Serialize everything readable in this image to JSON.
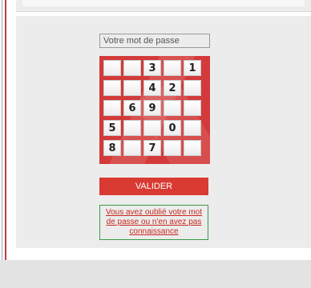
{
  "password": {
    "placeholder": "Votre mot de passe",
    "value": ""
  },
  "keypad": {
    "cells": [
      "",
      "",
      "3",
      "",
      "1",
      "",
      "",
      "4",
      "2",
      "",
      "",
      "6",
      "9",
      "",
      "",
      "5",
      "",
      "",
      "0",
      "",
      "8",
      "",
      "7",
      "",
      ""
    ]
  },
  "submit": {
    "label": "VALIDER"
  },
  "forgot": {
    "text": "Vous avez oublié votre mot de passe ou n'en avez pas connaissance"
  },
  "colors": {
    "accent": "#d93a32",
    "link": "#c8281e",
    "forgot_border": "#3c9a4a"
  }
}
